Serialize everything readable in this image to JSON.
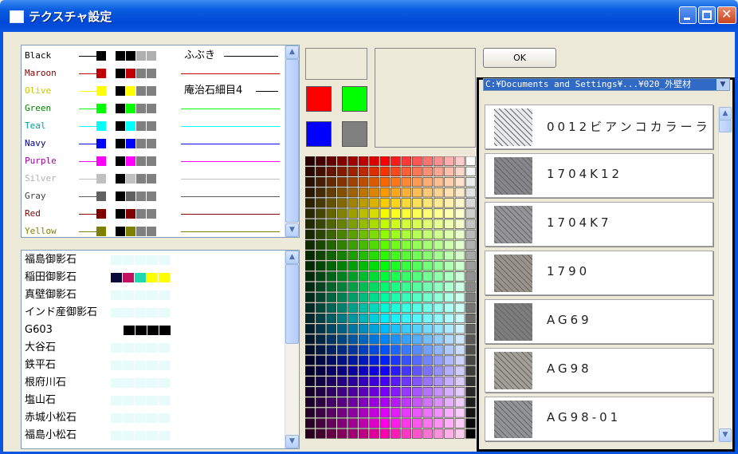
{
  "window": {
    "title": "テクスチャ設定"
  },
  "colors": [
    {
      "name": "Black",
      "color": "#000000",
      "text_color": "#000000"
    },
    {
      "name": "Maroon",
      "color": "#c00000",
      "text_color": "#800000"
    },
    {
      "name": "Olive",
      "color": "#ffff00",
      "text_color": "#c8c800"
    },
    {
      "name": "Green",
      "color": "#00ff00",
      "text_color": "#008000"
    },
    {
      "name": "Teal",
      "color": "#00ffff",
      "text_color": "#00a0a0"
    },
    {
      "name": "Navy",
      "color": "#0000ff",
      "text_color": "#000080"
    },
    {
      "name": "Purple",
      "color": "#ff00ff",
      "text_color": "#a000a0"
    },
    {
      "name": "Silver",
      "color": "#c0c0c0",
      "text_color": "#b0b0b0"
    },
    {
      "name": "Gray",
      "color": "#606060",
      "text_color": "#404040"
    },
    {
      "name": "Red",
      "color": "#800000",
      "text_color": "#800000"
    },
    {
      "name": "Yellow",
      "color": "#808000",
      "text_color": "#808000"
    }
  ],
  "color_extra_labels": [
    {
      "row": 0,
      "text": "ふぶき"
    },
    {
      "row": 2,
      "text": "庵治石細目4"
    }
  ],
  "stones": [
    "福島御影石",
    "稲田御影石",
    "真壁御影石",
    "インド産御影石",
    "G603",
    "大谷石",
    "鉄平石",
    "根府川石",
    "塩山石",
    "赤城小松石",
    "福島小松石"
  ],
  "stone_swatches": {
    "稲田御影石": [
      "#0a0a3a",
      "#c01060",
      "#20d8b0",
      "#ffff00",
      "#ffff00"
    ],
    "G603": [
      "#000000",
      "#000000",
      "#000000",
      "#000000"
    ]
  },
  "quick_colors": [
    "#ff0000",
    "#00ff00",
    "#0000ff",
    "#808080"
  ],
  "ok_label": "OK",
  "texture_path": "C:¥Documents and Settings¥...¥020_外壁材",
  "textures": [
    "0012ビアンコカラーラ",
    "1704K12",
    "1704K7",
    "1790",
    "AG69",
    "AG98",
    "AG98-01"
  ],
  "texture_tones": [
    "#e6e8ea",
    "#7a7a80",
    "#8a8a8c",
    "#8e8880",
    "#707070",
    "#9a948c",
    "#86888a"
  ]
}
